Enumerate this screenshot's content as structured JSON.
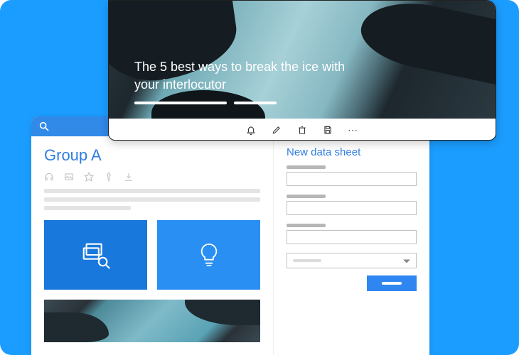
{
  "back_window": {
    "title": "Group A",
    "action_icons": [
      "headphones-icon",
      "image-icon",
      "star-icon",
      "pin-icon",
      "download-icon"
    ],
    "card_icons": [
      "layers-search-icon",
      "lightbulb-icon"
    ],
    "form": {
      "title": "New data sheet",
      "fields": [
        "field1",
        "field2",
        "field3"
      ],
      "select_placeholder": "",
      "submit_label": ""
    }
  },
  "front_window": {
    "hero_title": "The 5 best ways to break the ice with your interlocutor",
    "toolbar_icons": [
      "bell-icon",
      "edit-icon",
      "delete-icon",
      "save-icon",
      "more-icon"
    ]
  },
  "colors": {
    "stage_bg": "#1b9dff",
    "accent": "#2f7de0"
  }
}
